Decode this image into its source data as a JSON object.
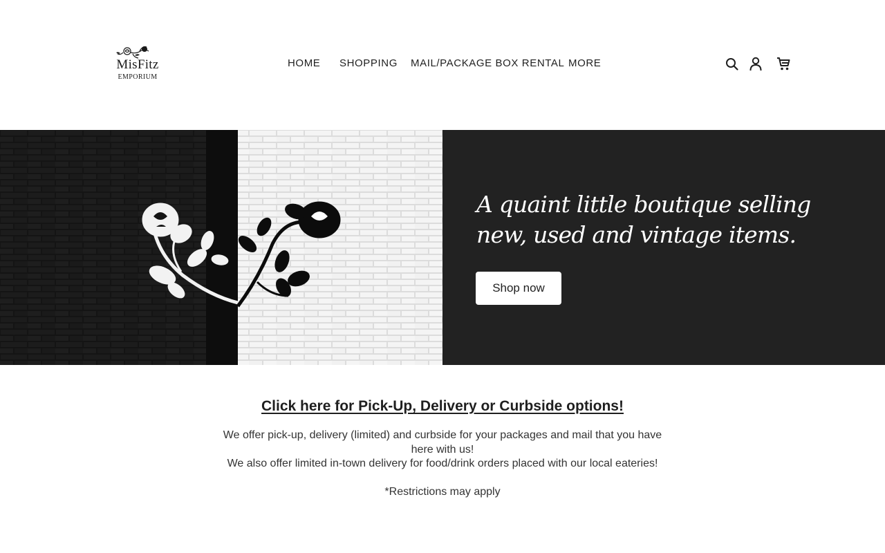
{
  "header": {
    "logo": {
      "name": "MisFitz",
      "subtitle": "EMPORIUM"
    },
    "nav": [
      {
        "label": "HOME"
      },
      {
        "label": "SHOPPING"
      },
      {
        "label": "MAIL/PACKAGE BOX RENTAL"
      },
      {
        "label": "MORE"
      }
    ],
    "icons": [
      "search-icon",
      "account-icon",
      "cart-icon"
    ]
  },
  "hero": {
    "title": "A quaint little boutique selling new, used and vintage items.",
    "button_label": "Shop now",
    "panel_color": "#222222"
  },
  "info": {
    "link_text": "Click here for Pick-Up, Delivery or Curbside options!",
    "line1": "We offer pick-up, delivery (limited) and curbside for your packages and mail that you have here with us!",
    "line2": "We also offer limited in-town delivery for food/drink orders placed with our local eateries!",
    "note": "*Restrictions may apply"
  }
}
